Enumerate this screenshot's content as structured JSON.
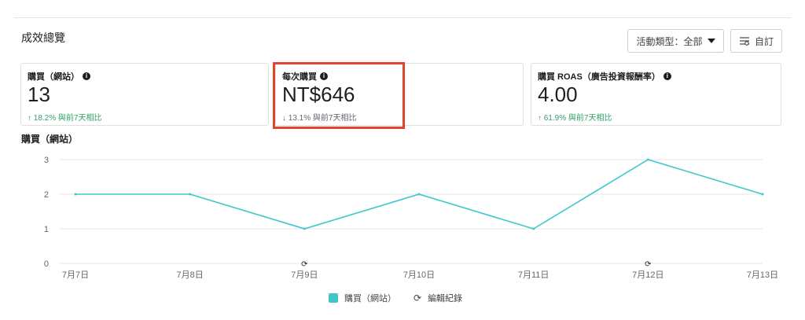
{
  "panel": {
    "title": "成效總覽",
    "activity_button": "活動類型：全部",
    "custom_button": "自訂"
  },
  "cards": [
    {
      "label": "購買（網站）",
      "value": "13",
      "delta_arrow": "↑",
      "delta": "18.2% 與前7天相比",
      "trend": "up"
    },
    {
      "label": "每次購買",
      "value": "NT$646",
      "delta_arrow": "↓",
      "delta": "13.1% 與前7天相比",
      "trend": "down"
    },
    {
      "label": "購買 ROAS（廣告投資報酬率）",
      "value": "4.00",
      "delta_arrow": "↑",
      "delta": "61.9% 與前7天相比",
      "trend": "up"
    }
  ],
  "chart_title": "購買（網站）",
  "legend": {
    "series_label": "購買（網站）",
    "edit_label": "編輯紀錄"
  },
  "colors": {
    "series": "#3fc7cc",
    "highlight": "#e0442d",
    "up": "#31a06a"
  },
  "chart_data": {
    "type": "line",
    "x": [
      "7月7日",
      "7月8日",
      "7月9日",
      "7月10日",
      "7月11日",
      "7月12日",
      "7月13日"
    ],
    "series": [
      {
        "name": "購買（網站）",
        "values": [
          2,
          2,
          1,
          2,
          1,
          3,
          2
        ]
      }
    ],
    "yticks": [
      0,
      1,
      2,
      3
    ],
    "ylim": [
      0,
      3
    ],
    "edit_markers": [
      "7月9日",
      "7月12日"
    ],
    "grid": true,
    "legend": "bottom"
  }
}
